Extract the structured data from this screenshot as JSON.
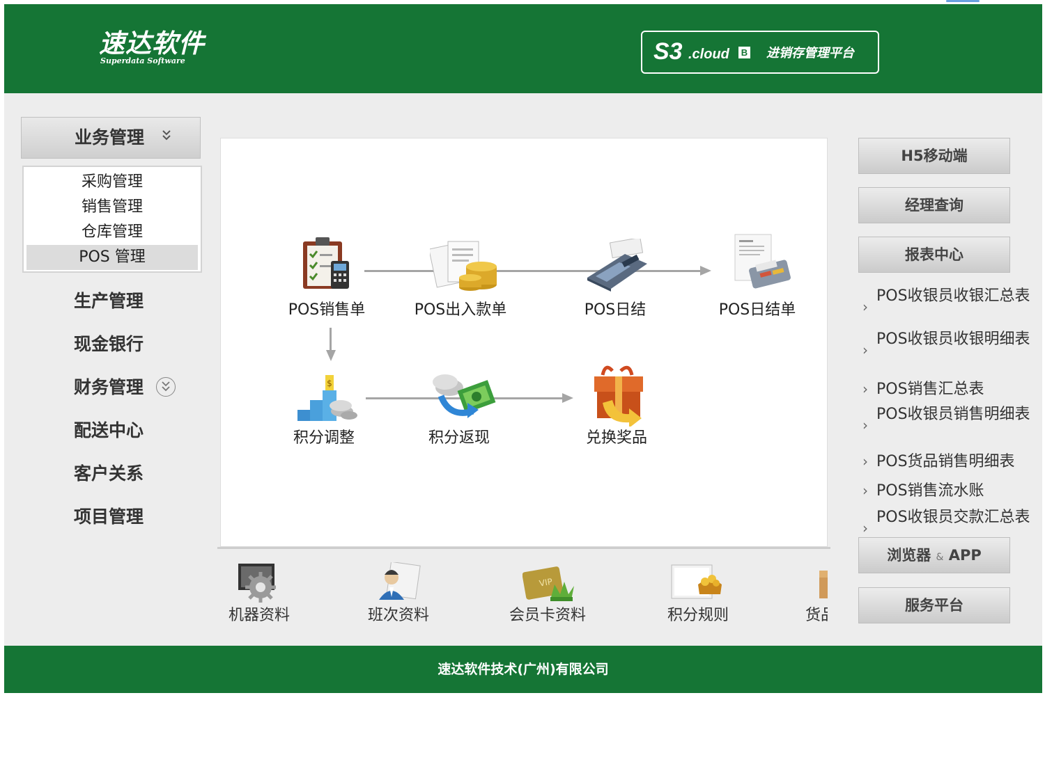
{
  "header": {
    "logo_cn": "速达软件",
    "logo_en": "Superdata Software",
    "brand_s3": "S3",
    "brand_cloud": ".cloud",
    "brand_edition": "B",
    "brand_platform": "进销存管理平台",
    "color": "#157535"
  },
  "nav": {
    "section": {
      "label": "业务管理",
      "icon": "double-chevron-down-icon"
    },
    "submenu": [
      {
        "label": "采购管理"
      },
      {
        "label": "销售管理"
      },
      {
        "label": "仓库管理"
      },
      {
        "label": "POS 管理",
        "selected": true
      }
    ],
    "items": [
      {
        "label": "生产管理"
      },
      {
        "label": "现金银行"
      },
      {
        "label": "财务管理",
        "icon": "circle-chevron-down-icon"
      },
      {
        "label": "配送中心"
      },
      {
        "label": "客户关系"
      },
      {
        "label": "项目管理"
      }
    ]
  },
  "flow": {
    "row1": [
      {
        "label": "POS销售单",
        "icon": "clipboard-icon"
      },
      {
        "label": "POS出入款单",
        "icon": "coins-documents-icon"
      },
      {
        "label": "POS日结",
        "icon": "card-terminal-icon"
      },
      {
        "label": "POS日结单",
        "icon": "receipt-printer-icon"
      }
    ],
    "row2": [
      {
        "label": "积分调整",
        "icon": "stairs-coins-icon"
      },
      {
        "label": "积分返现",
        "icon": "cash-refund-icon"
      },
      {
        "label": "兑换奖品",
        "icon": "gift-box-icon"
      }
    ]
  },
  "strip": [
    {
      "label": "机器资料",
      "icon": "machine-gear-icon"
    },
    {
      "label": "班次资料",
      "icon": "staff-card-icon"
    },
    {
      "label": "会员卡资料",
      "icon": "vip-card-icon"
    },
    {
      "label": "积分规则",
      "icon": "points-rule-icon"
    },
    {
      "label": "货品资料",
      "icon": "goods-box-icon"
    }
  ],
  "right": {
    "buttons_top": [
      {
        "label": "H5移动端"
      },
      {
        "label": "经理查询"
      },
      {
        "label": "报表中心"
      }
    ],
    "reports": [
      {
        "label": "POS收银员收银汇总表"
      },
      {
        "label": "POS收银员收银明细表"
      },
      {
        "label": "POS销售汇总表"
      },
      {
        "label": "POS收银员销售明细表"
      },
      {
        "label": "POS货品销售明细表"
      },
      {
        "label": "POS销售流水账"
      },
      {
        "label": "POS收银员交款汇总表"
      }
    ],
    "buttons_bottom": [
      {
        "label_a": "浏览器",
        "label_amp": "&",
        "label_b": "APP"
      },
      {
        "label": "服务平台"
      }
    ]
  },
  "footer": {
    "text": "速达软件技术(广州)有限公司"
  }
}
